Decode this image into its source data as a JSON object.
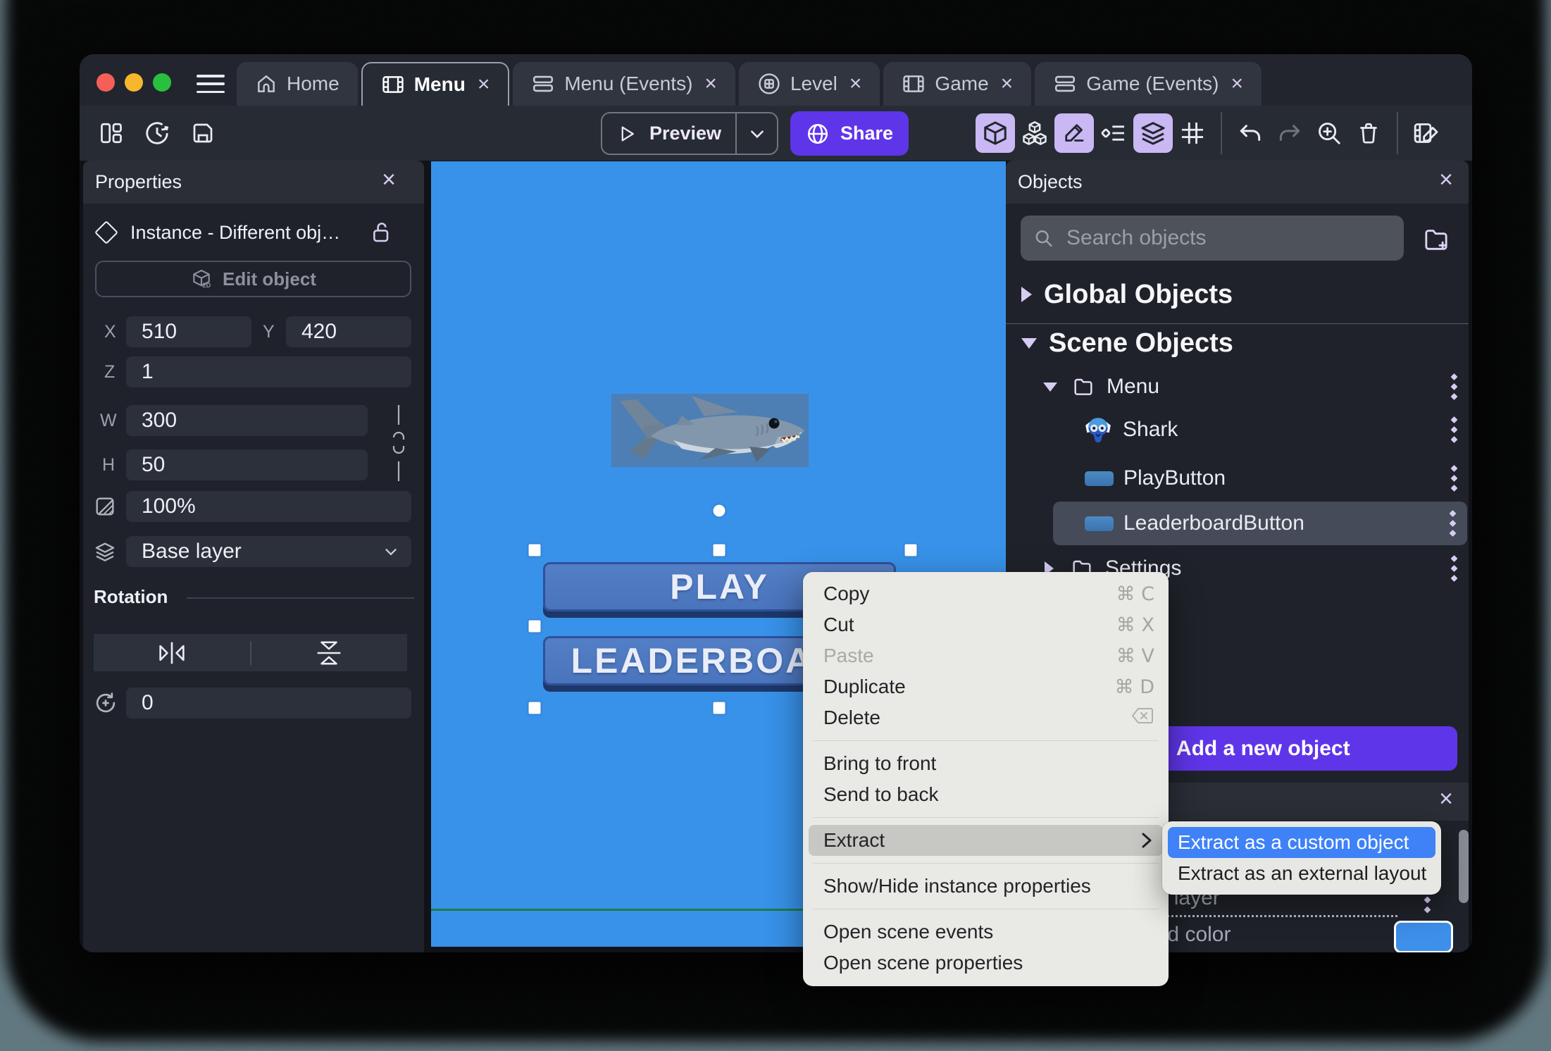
{
  "colors": {
    "accent_purple": "#5f35e9",
    "scene_blue": "#3892e9",
    "scene_green": "#1b7d45",
    "mac_highlight_blue": "#3f82f7",
    "toolbar_toggle_lavender": "#c9b8f3",
    "background_swatch_blue": "#3d8fe9"
  },
  "titlebar": {
    "tabs": [
      {
        "label": "Home",
        "icon": "home-icon",
        "active": false,
        "closable": false
      },
      {
        "label": "Menu",
        "icon": "scene-icon",
        "active": true,
        "closable": true
      },
      {
        "label": "Menu (Events)",
        "icon": "events-icon",
        "active": false,
        "closable": true
      },
      {
        "label": "Level",
        "icon": "external-layout-icon",
        "active": false,
        "closable": true
      },
      {
        "label": "Game",
        "icon": "scene-icon",
        "active": false,
        "closable": true
      },
      {
        "label": "Game (Events)",
        "icon": "events-icon",
        "active": false,
        "closable": true
      }
    ],
    "close_glyph": "×"
  },
  "toolbar": {
    "preview_label": "Preview",
    "share_label": "Share"
  },
  "properties": {
    "title": "Properties",
    "instance_row": "Instance  -  Different obj…",
    "edit_object_label": "Edit object",
    "x_label": "X",
    "x_value": "510",
    "y_label": "Y",
    "y_value": "420",
    "z_label": "Z",
    "z_value": "1",
    "w_label": "W",
    "w_value": "300",
    "h_label": "H",
    "h_value": "50",
    "opacity_value": "100%",
    "layer_value": "Base layer",
    "rotation_title": "Rotation",
    "rotation_value": "0"
  },
  "canvas": {
    "play_label": "PLAY",
    "leaderboard_label": "LEADERBOARD"
  },
  "objects": {
    "title": "Objects",
    "search_placeholder": "Search objects",
    "global_header": "Global Objects",
    "scene_header": "Scene Objects",
    "tree": [
      {
        "label": "Menu",
        "type": "folder",
        "expanded": true
      },
      {
        "label": "Shark",
        "type": "sprite"
      },
      {
        "label": "PlayButton",
        "type": "button"
      },
      {
        "label": "LeaderboardButton",
        "type": "button",
        "selected": true
      },
      {
        "label": "Settings",
        "type": "folder",
        "expanded": false
      }
    ],
    "add_button_label": "Add a new object",
    "add_button_plus": "+"
  },
  "layers_panel": {
    "layer_name": "Base layer",
    "background_color_label": "Background color"
  },
  "context_menu": {
    "items": [
      {
        "label": "Copy",
        "shortcut": "⌘ C"
      },
      {
        "label": "Cut",
        "shortcut": "⌘ X"
      },
      {
        "label": "Paste",
        "shortcut": "⌘ V",
        "disabled": true
      },
      {
        "label": "Duplicate",
        "shortcut": "⌘ D"
      },
      {
        "label": "Delete",
        "icon": "delete-key-icon"
      },
      {
        "label": "Bring to front"
      },
      {
        "label": "Send to back"
      },
      {
        "label": "Extract",
        "submenu": true,
        "highlighted": true
      },
      {
        "label": "Show/Hide instance properties"
      },
      {
        "label": "Open scene events"
      },
      {
        "label": "Open scene properties"
      }
    ]
  },
  "submenu": {
    "items": [
      {
        "label": "Extract as a custom object",
        "highlighted": true
      },
      {
        "label": "Extract as an external layout"
      }
    ]
  }
}
